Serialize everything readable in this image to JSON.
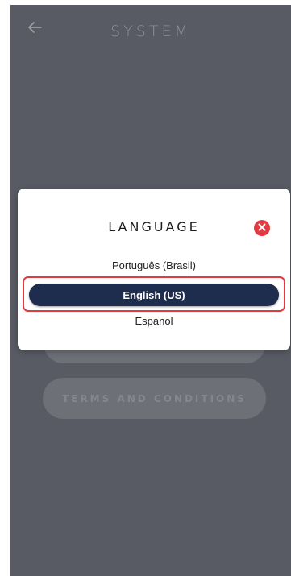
{
  "header": {
    "title": "SYSTEM",
    "back_icon": "arrow-left-icon"
  },
  "background_buttons": {
    "first_label": "",
    "terms_label": "TERMS AND CONDITIONS"
  },
  "language_modal": {
    "title": "LANGUAGE",
    "close_icon": "close-icon",
    "options": [
      {
        "label": "Português (Brasil)",
        "selected": false
      },
      {
        "label": "English (US)",
        "selected": true
      },
      {
        "label": "Espanol",
        "selected": false
      }
    ]
  },
  "colors": {
    "screen_bg": "#585b64",
    "selected_option_bg": "#1e2d4d",
    "close_button": "#e53a43",
    "highlight_border": "#e23a3f"
  }
}
